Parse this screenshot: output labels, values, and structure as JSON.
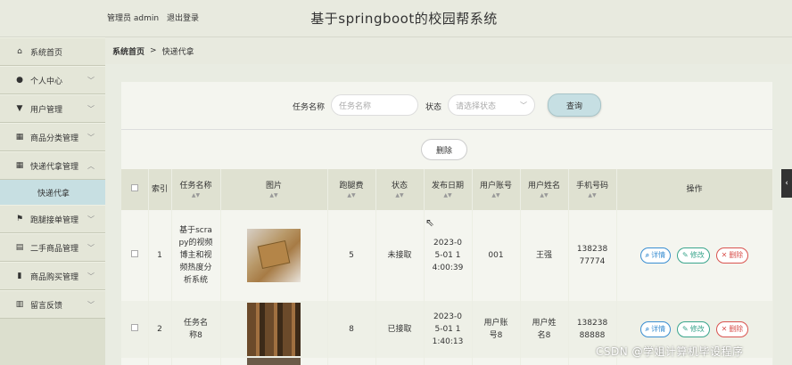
{
  "header": {
    "user_label": "管理员 admin",
    "logout": "退出登录",
    "title": "基于springboot的校园帮系统"
  },
  "sidebar": {
    "items": [
      {
        "label": "系统首页",
        "icon": "home-icon",
        "glyph": "⌂"
      },
      {
        "label": "个人中心",
        "icon": "person-icon",
        "glyph": "●"
      },
      {
        "label": "用户管理",
        "icon": "user-icon",
        "glyph": "▼"
      },
      {
        "label": "商品分类管理",
        "icon": "grid-icon",
        "glyph": "▦"
      },
      {
        "label": "快递代拿管理",
        "icon": "grid-icon",
        "glyph": "▦"
      },
      {
        "label": "跑腿接单管理",
        "icon": "flag-icon",
        "glyph": "⚑"
      },
      {
        "label": "二手商品管理",
        "icon": "clipboard-icon",
        "glyph": "▤"
      },
      {
        "label": "商品购买管理",
        "icon": "bar-chart-icon",
        "glyph": "▮"
      },
      {
        "label": "留言反馈",
        "icon": "book-icon",
        "glyph": "▥"
      }
    ],
    "sub_item": "快递代拿"
  },
  "breadcrumb": {
    "home": "系统首页",
    "sep": ">",
    "current": "快递代拿"
  },
  "search": {
    "name_label": "任务名称",
    "name_placeholder": "任务名称",
    "status_label": "状态",
    "status_placeholder": "请选择状态",
    "query_button": "查询",
    "delete_button": "删除"
  },
  "table": {
    "headers": [
      "索引",
      "任务名称",
      "图片",
      "跑腿费",
      "状态",
      "发布日期",
      "用户账号",
      "用户姓名",
      "手机号码",
      "操作"
    ],
    "rows": [
      {
        "index": "1",
        "name": "基于scrapy的视频博主和视频热度分析系统",
        "fee": "5",
        "status": "未接取",
        "date": "2023-05-01 14:00:39",
        "account": "001",
        "username": "王强",
        "phone": "13823877774"
      },
      {
        "index": "2",
        "name": "任务名称8",
        "fee": "8",
        "status": "已接取",
        "date": "2023-05-01 11:40:13",
        "account": "用户账号8",
        "username": "用户姓名8",
        "phone": "13823888888"
      }
    ],
    "actions": {
      "detail": "详情",
      "edit": "修改",
      "delete": "删除"
    }
  },
  "watermark": "CSDN @学姐计算机毕设程序"
}
